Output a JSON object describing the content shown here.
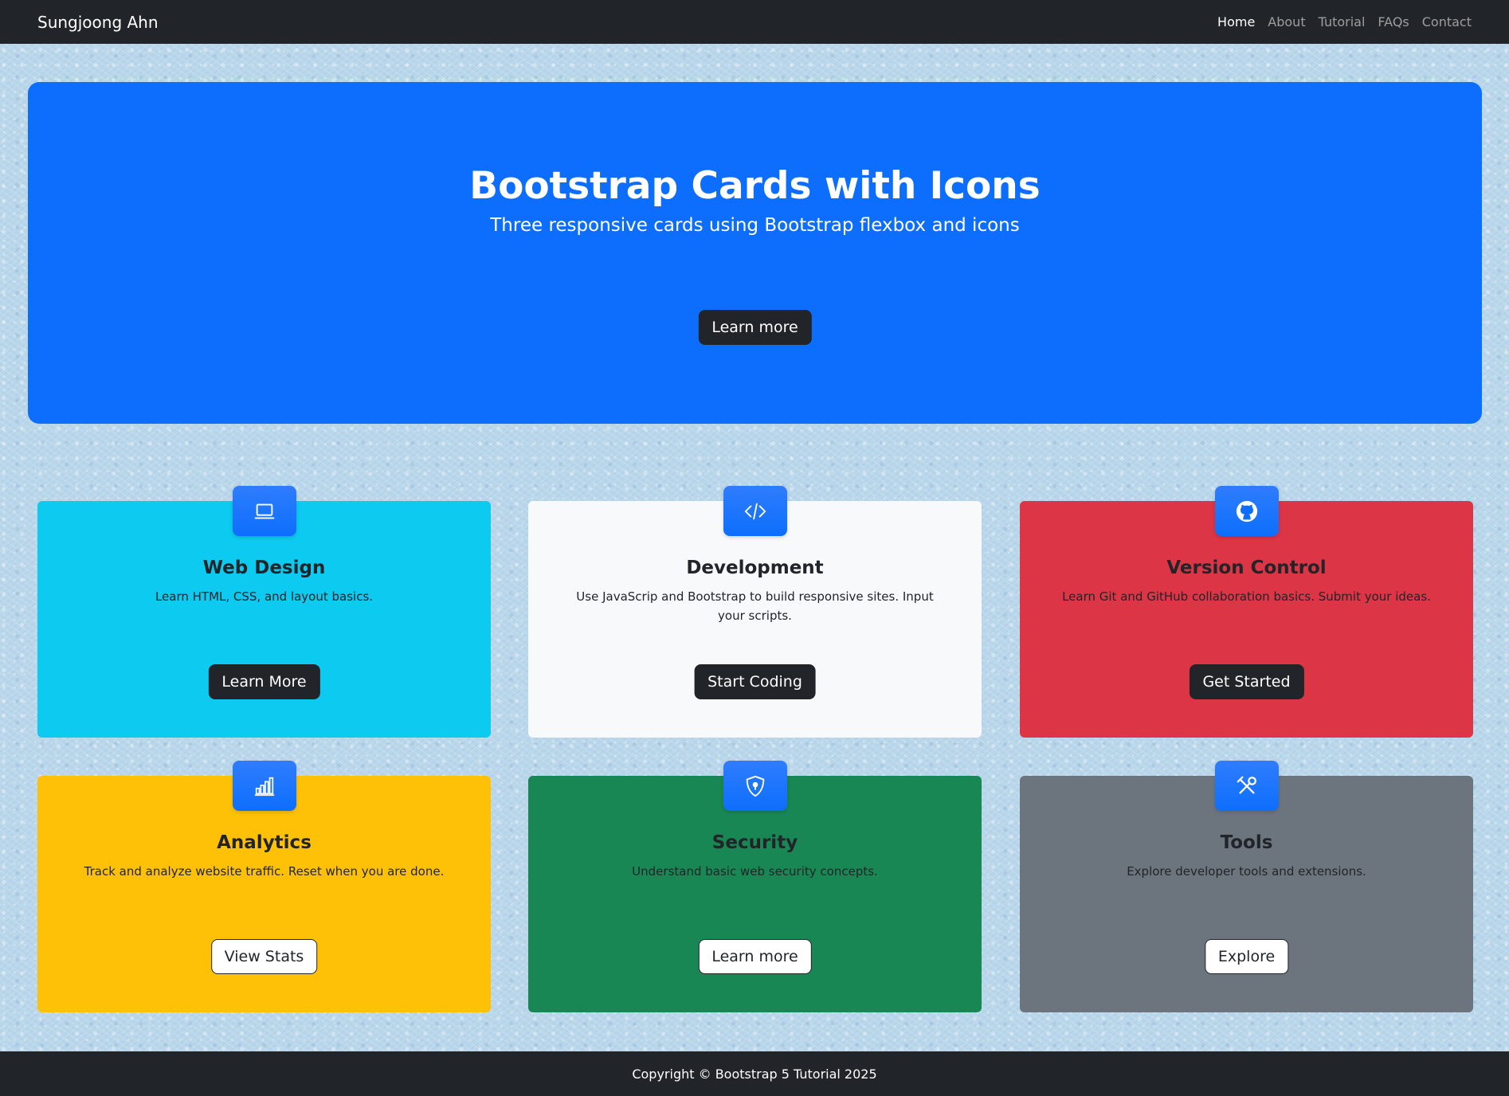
{
  "nav": {
    "brand": "Sungjoong Ahn",
    "links": [
      "Home",
      "About",
      "Tutorial",
      "FAQs",
      "Contact"
    ]
  },
  "hero": {
    "title": "Bootstrap Cards with Icons",
    "subtitle": "Three responsive cards using Bootstrap flexbox and icons",
    "button": "Learn more"
  },
  "cards": [
    {
      "icon": "laptop-icon",
      "title": "Web Design",
      "text": "Learn HTML, CSS, and layout basics.",
      "button": "Learn More",
      "color": "#0dcaf0"
    },
    {
      "icon": "code-icon",
      "title": "Development",
      "text": "Use JavaScrip and Bootstrap to build responsive sites. Input your scripts.",
      "button": "Start Coding",
      "color": "#f8f9fa"
    },
    {
      "icon": "github-icon",
      "title": "Version Control",
      "text": "Learn Git and GitHub collaboration basics. Submit your ideas.",
      "button": "Get Started",
      "color": "#dc3545"
    },
    {
      "icon": "bar-chart-icon",
      "title": "Analytics",
      "text": "Track and analyze website traffic. Reset when you are done.",
      "button": "View Stats",
      "color": "#ffc107"
    },
    {
      "icon": "shield-lock-icon",
      "title": "Security",
      "text": "Understand basic web security concepts.",
      "button": "Learn more",
      "color": "#198754"
    },
    {
      "icon": "tools-icon",
      "title": "Tools",
      "text": "Explore developer tools and extensions.",
      "button": "Explore",
      "color": "#6c757d"
    }
  ],
  "footer": {
    "text": "Copyright © Bootstrap 5 Tutorial 2025"
  },
  "colors": {
    "navbar": "#212529",
    "hero": "#0d6efd",
    "icon_box": "#0d6efd"
  }
}
